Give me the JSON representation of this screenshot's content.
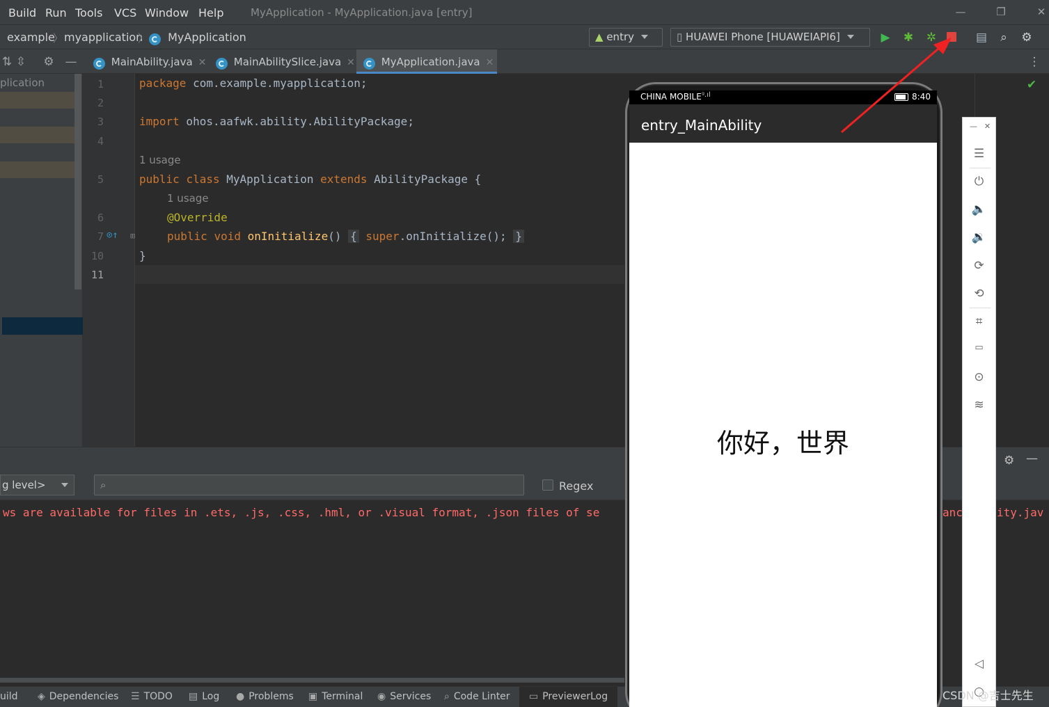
{
  "menu": {
    "items": [
      "Build",
      "Run",
      "Tools",
      "VCS",
      "Window",
      "Help"
    ],
    "window_title": "MyApplication - MyApplication.java [entry]"
  },
  "nav": {
    "crumbs": [
      "example",
      "myapplication",
      "MyApplication"
    ],
    "run_config": "entry",
    "device": "HUAWEI Phone [HUAWEIAPI6]"
  },
  "tabs": [
    {
      "label": "MainAbility.java"
    },
    {
      "label": "MainAbilitySlice.java"
    },
    {
      "label": "MyApplication.java"
    }
  ],
  "project": {
    "label": "plication"
  },
  "editor": {
    "line_numbers": [
      "1",
      "2",
      "3",
      "4",
      "5",
      "6",
      "7",
      "10",
      "11"
    ],
    "usage_hint_1": "1 usage",
    "usage_hint_2": "1 usage",
    "l1_kw": "package",
    "l1_rest": " com.example.myapplication;",
    "l3_kw": "import",
    "l3_rest": " ohos.aafwk.ability.AbilityPackage;",
    "l5_kw1": "public",
    "l5_kw2": "class",
    "l5_name": " MyApplication ",
    "l5_kw3": "extends",
    "l5_rest": " AbilityPackage {",
    "l6_annotation": "@Override",
    "l7_kw1": "public",
    "l7_kw2": "void",
    "l7_fn": " onInitialize",
    "l7_parens": "()",
    "l7_open": "{",
    "l7_super": "super",
    "l7_call": ".onInitialize();",
    "l7_close": "}",
    "l10": "}"
  },
  "log": {
    "level": "g level>",
    "search_placeholder": "",
    "regex_label": "Regex",
    "message": "ws are available for files in .ets, .js, .css, .hml, or .visual format, .json files of se",
    "message_tail_1": "anc",
    "message_tail_2": "ity.jav"
  },
  "tool_windows": [
    {
      "label": "uild",
      "icon": "build-icon"
    },
    {
      "label": "Dependencies",
      "icon": "layers-icon"
    },
    {
      "label": "TODO",
      "icon": "list-icon"
    },
    {
      "label": "Log",
      "icon": "log-icon"
    },
    {
      "label": "Problems",
      "icon": "info-icon"
    },
    {
      "label": "Terminal",
      "icon": "terminal-icon"
    },
    {
      "label": "Services",
      "icon": "play-circle-icon"
    },
    {
      "label": "Code Linter",
      "icon": "search-icon"
    },
    {
      "label": "PreviewerLog",
      "icon": "doc-icon"
    }
  ],
  "phone": {
    "carrier": "CHINA MOBILE",
    "time": "8:40",
    "app_title": "entry_MainAbility",
    "content_text": "你好，世界"
  },
  "watermark": "CSDN @吉士先生",
  "colors": {
    "keyword": "#cc7832",
    "function": "#ffc66d",
    "annotation": "#bbb529",
    "error_text": "#ff6b68",
    "run_green": "#3fb950",
    "stop_red": "#e0443e",
    "accent_blue": "#4a88c7"
  }
}
